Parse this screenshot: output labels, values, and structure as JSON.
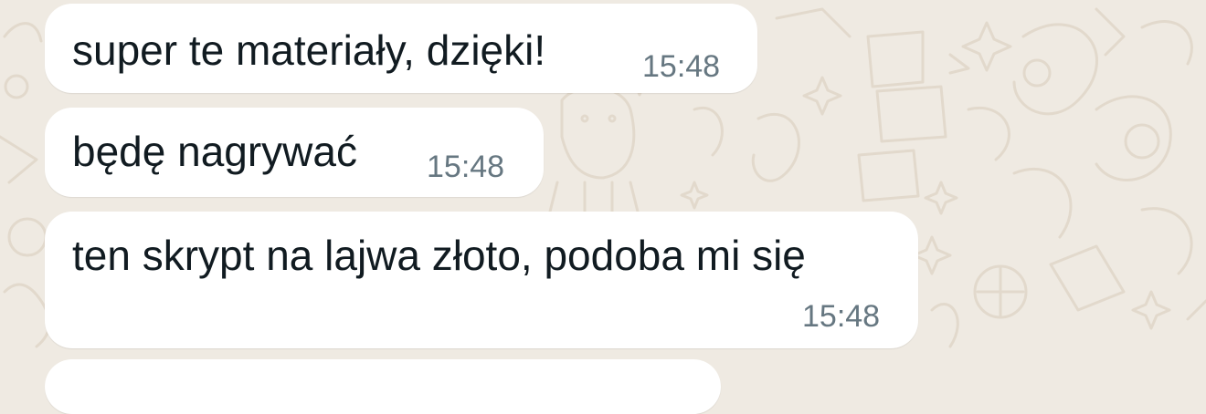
{
  "theme": {
    "wallpaper_color": "#efeae2",
    "bubble_color": "#ffffff",
    "text_color": "#111b21",
    "time_color": "#667781"
  },
  "messages": [
    {
      "text": "super te materiały, dzięki!",
      "time": "15:48"
    },
    {
      "text": "będę nagrywać",
      "time": "15:48"
    },
    {
      "text": "ten skrypt na lajwa złoto, podoba mi się",
      "time": "15:48"
    }
  ]
}
